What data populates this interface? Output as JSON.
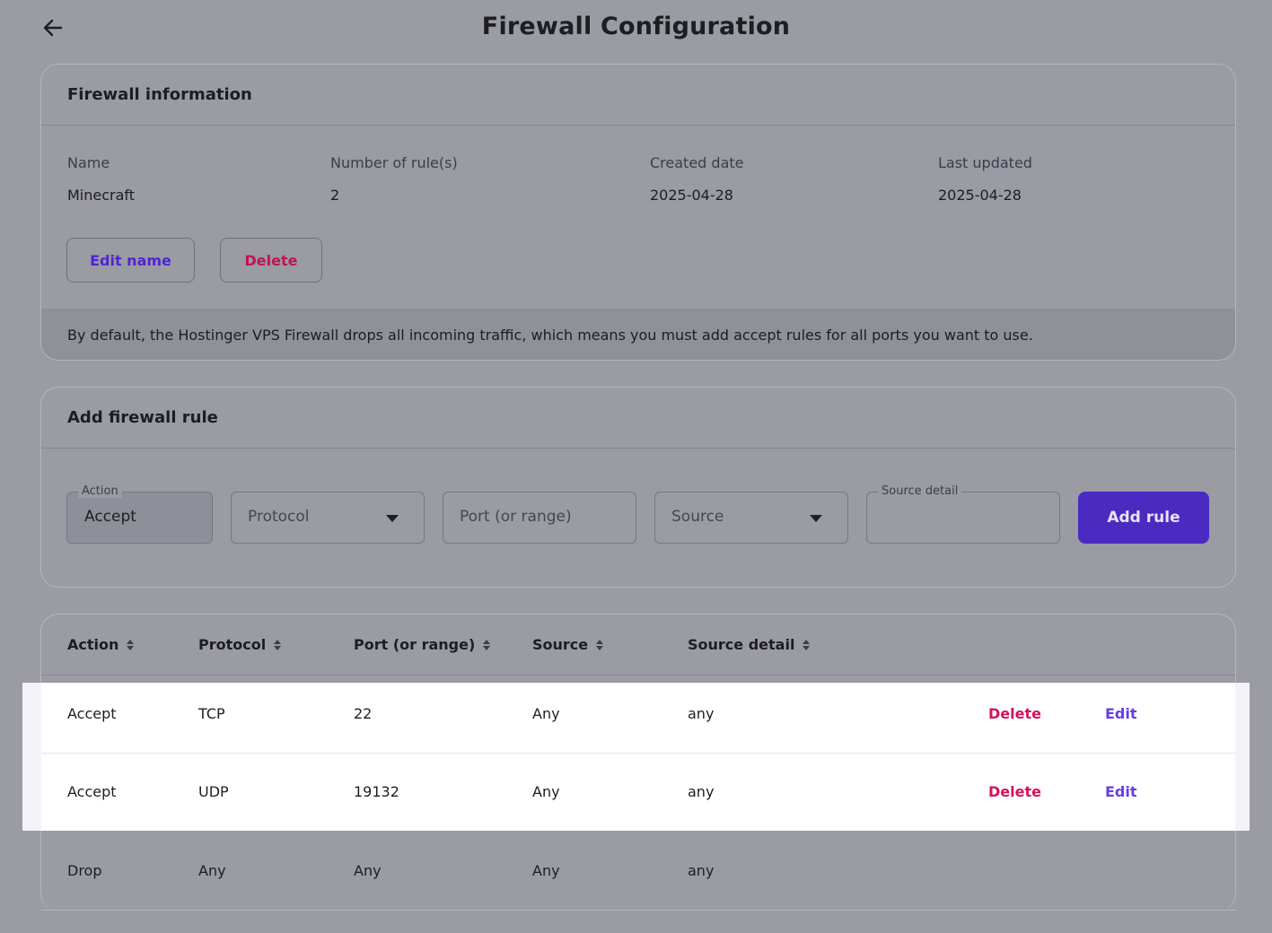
{
  "page": {
    "title": "Firewall Configuration",
    "back_icon": "arrow-left-icon"
  },
  "info": {
    "header": "Firewall information",
    "fields": [
      {
        "label": "Name",
        "value": "Minecraft"
      },
      {
        "label": "Number of rule(s)",
        "value": "2"
      },
      {
        "label": "Created date",
        "value": "2025-04-28"
      },
      {
        "label": "Last updated",
        "value": "2025-04-28"
      }
    ],
    "edit_name_label": "Edit name",
    "delete_label": "Delete",
    "note": "By default, the Hostinger VPS Firewall drops all incoming traffic, which means you must add accept rules for all ports you want to use."
  },
  "add_rule": {
    "header": "Add firewall rule",
    "action_label": "Action",
    "action_value": "Accept",
    "protocol_placeholder": "Protocol",
    "port_placeholder": "Port (or range)",
    "source_placeholder": "Source",
    "source_detail_label": "Source detail",
    "source_detail_value": "",
    "submit_label": "Add rule"
  },
  "rules_table": {
    "columns": [
      "Action",
      "Protocol",
      "Port (or range)",
      "Source",
      "Source detail"
    ],
    "rows": [
      {
        "action": "Accept",
        "protocol": "TCP",
        "port": "22",
        "source": "Any",
        "source_detail": "any",
        "delete_label": "Delete",
        "edit_label": "Edit"
      },
      {
        "action": "Accept",
        "protocol": "UDP",
        "port": "19132",
        "source": "Any",
        "source_detail": "any",
        "delete_label": "Delete",
        "edit_label": "Edit"
      },
      {
        "action": "Drop",
        "protocol": "Any",
        "port": "Any",
        "source": "Any",
        "source_detail": "any"
      }
    ]
  },
  "colors": {
    "primary": "#673de6",
    "danger": "#d1135a",
    "overlay": "#9a9ba3"
  }
}
